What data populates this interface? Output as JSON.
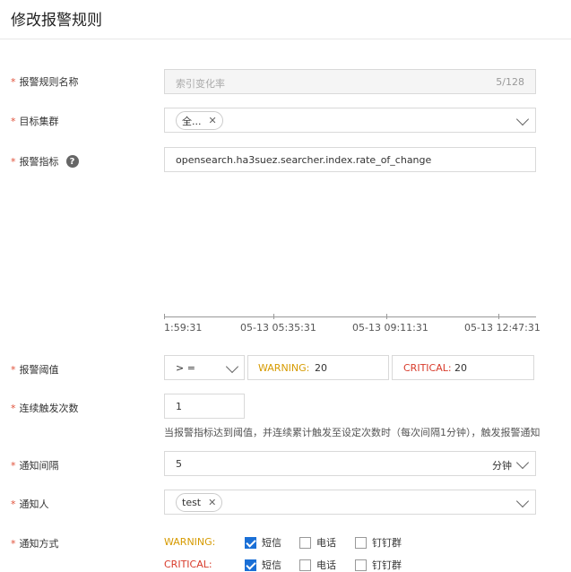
{
  "page": {
    "title": "修改报警规则"
  },
  "form": {
    "rule_name": {
      "label": "报警规则名称",
      "value": "索引变化率",
      "counter": "5/128"
    },
    "target_cluster": {
      "label": "目标集群",
      "tag": "全..."
    },
    "metric": {
      "label": "报警指标",
      "value": "opensearch.ha3suez.searcher.index.rate_of_change"
    },
    "chart_axis": {
      "ticks": [
        "1:59:31",
        "05-13 05:35:31",
        "05-13 09:11:31",
        "05-13 12:47:31"
      ]
    },
    "threshold": {
      "label": "报警阈值",
      "operator": "> =",
      "warning_label": "WARNING:",
      "warning_value": "20",
      "critical_label": "CRITICAL:",
      "critical_value": "20"
    },
    "consecutive": {
      "label": "连续触发次数",
      "value": "1",
      "hint": "当报警指标达到阈值，并连续累计触发至设定次数时（每次间隔1分钟），触发报警通知"
    },
    "interval": {
      "label": "通知间隔",
      "value": "5",
      "unit": "分钟"
    },
    "recipients": {
      "label": "通知人",
      "tag": "test"
    },
    "methods": {
      "label": "通知方式",
      "rows": [
        {
          "level": "WARNING:",
          "options": [
            {
              "label": "短信",
              "checked": true
            },
            {
              "label": "电话",
              "checked": false
            },
            {
              "label": "钉钉群",
              "checked": false
            }
          ]
        },
        {
          "level": "CRITICAL:",
          "options": [
            {
              "label": "短信",
              "checked": true
            },
            {
              "label": "电话",
              "checked": false
            },
            {
              "label": "钉钉群",
              "checked": false
            }
          ]
        }
      ]
    }
  }
}
